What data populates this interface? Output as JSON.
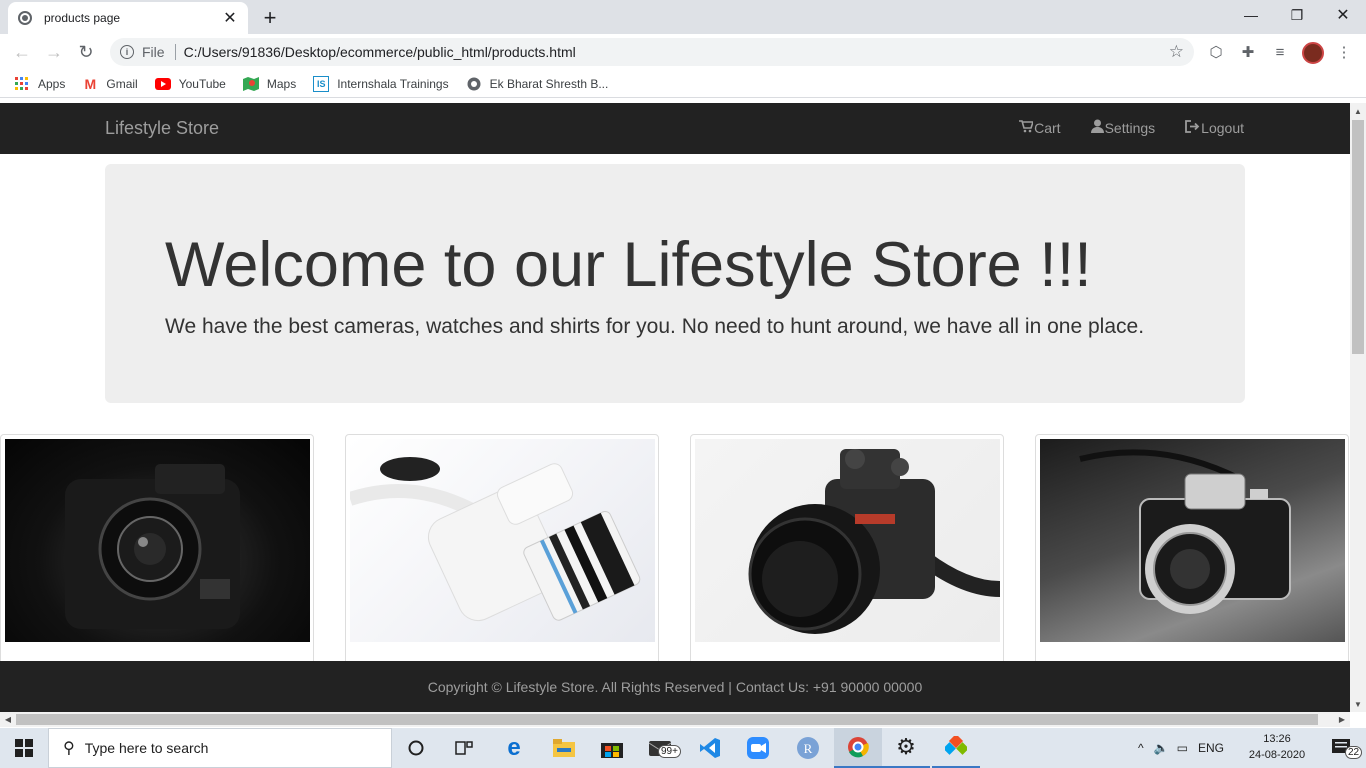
{
  "browser": {
    "tab_title": "products page",
    "tab_close": "✕",
    "new_tab": "+",
    "window_controls": {
      "minimize": "—",
      "restore": "❐",
      "close": "✕"
    },
    "scheme_label": "File",
    "url": "C:/Users/91836/Desktop/ecommerce/public_html/products.html",
    "bookmarks": [
      {
        "label": "Apps",
        "icon": "apps-grid-icon"
      },
      {
        "label": "Gmail",
        "icon": "gmail-icon"
      },
      {
        "label": "YouTube",
        "icon": "youtube-icon"
      },
      {
        "label": "Maps",
        "icon": "maps-icon"
      },
      {
        "label": "Internshala Trainings",
        "icon": "internshala-icon"
      },
      {
        "label": "Ek Bharat Shresth B...",
        "icon": "globe-icon"
      }
    ]
  },
  "page": {
    "brand": "Lifestyle Store",
    "nav": [
      {
        "label": "Cart",
        "icon": "cart-icon"
      },
      {
        "label": "Settings",
        "icon": "user-icon"
      },
      {
        "label": "Logout",
        "icon": "logout-icon"
      }
    ],
    "jumbotron": {
      "heading": "Welcome to our Lifestyle Store !!!",
      "text": "We have the best cameras, watches and shirts for you. No need to hunt around, we have all in one place."
    },
    "products": [
      {
        "icon": "canon-camera-image"
      },
      {
        "icon": "white-camera-image"
      },
      {
        "icon": "sony-camera-image"
      },
      {
        "icon": "olympus-camera-image"
      }
    ],
    "footer": "Copyright © Lifestyle Store. All Rights Reserved | Contact Us: +91 90000 00000"
  },
  "taskbar": {
    "search_placeholder": "Type here to search",
    "mail_badge": "99+",
    "language": "ENG",
    "time": "13:26",
    "date": "24-08-2020",
    "notification_count": "22"
  }
}
